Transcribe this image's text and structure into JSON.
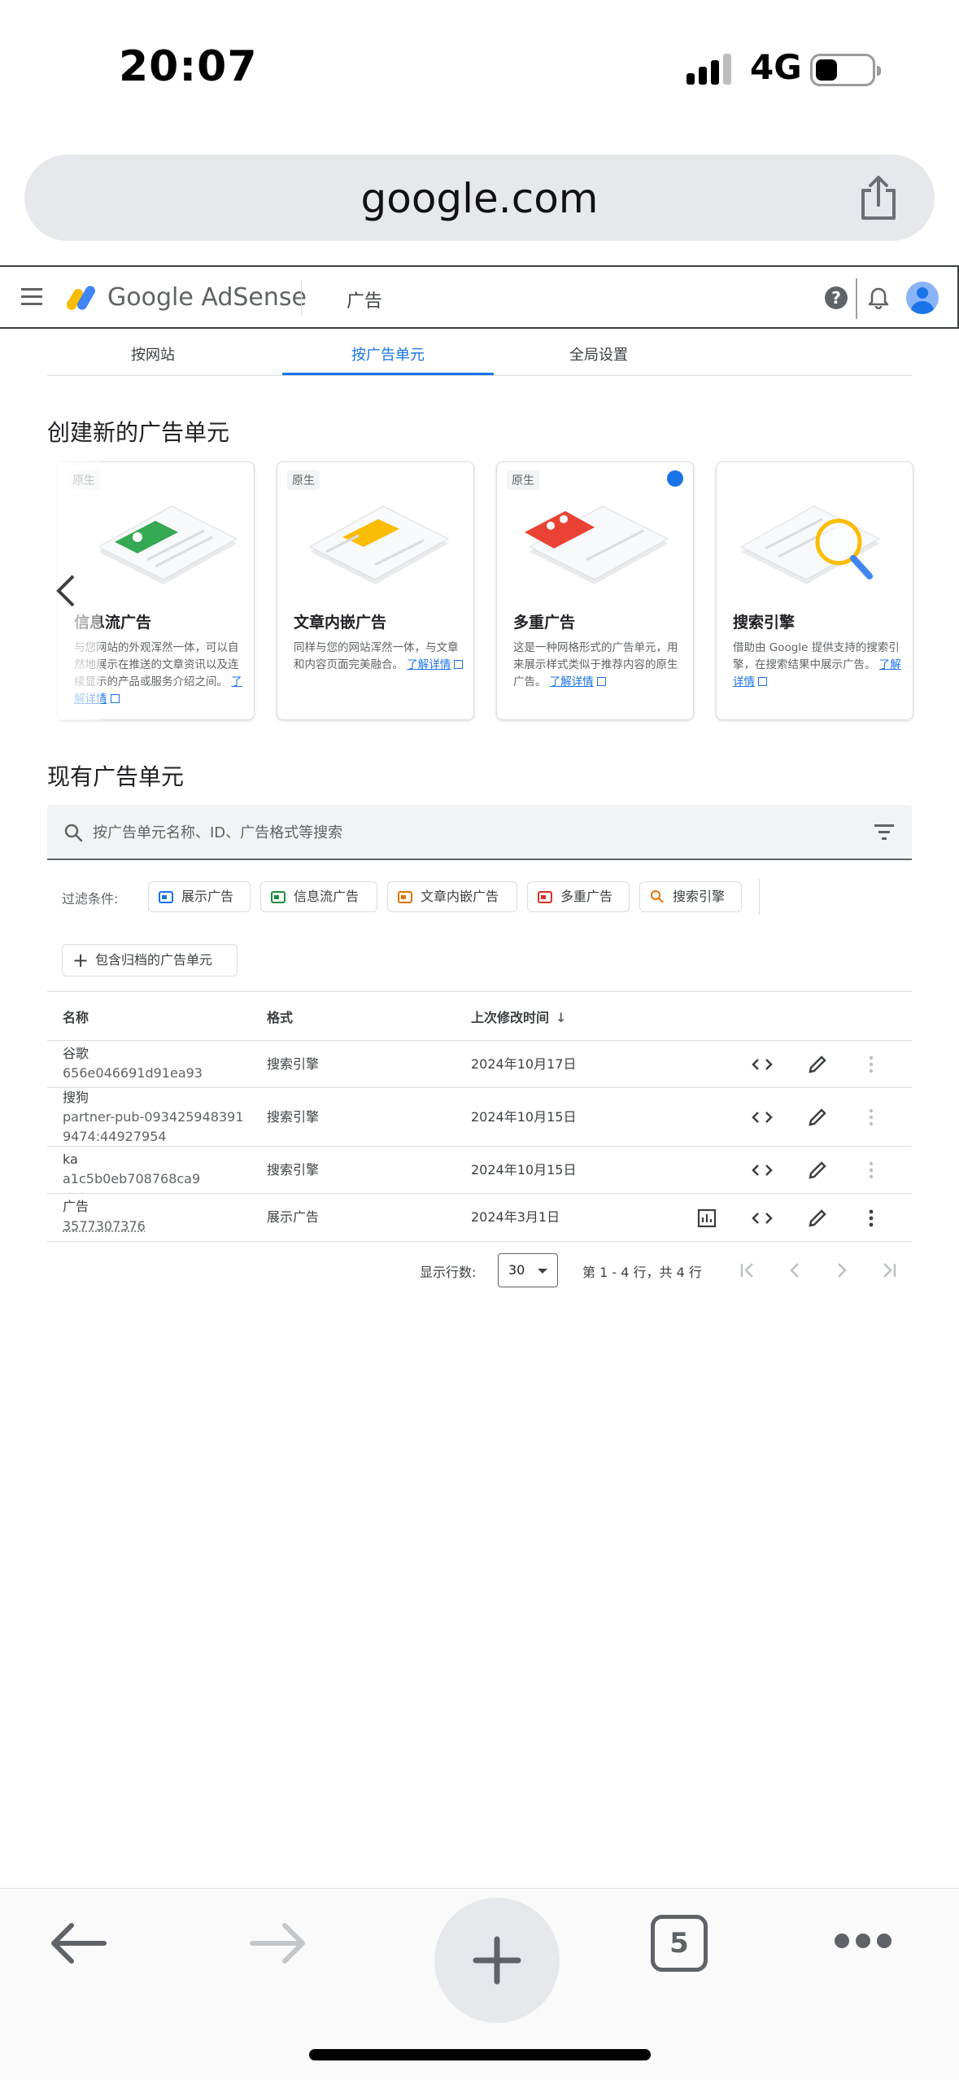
{
  "status_bar": {
    "time": "20:07",
    "network": "4G"
  },
  "browser": {
    "url": "google.com",
    "open_tabs": "5"
  },
  "header": {
    "brand": "Google AdSense",
    "section": "广告",
    "help": "?"
  },
  "tabs": [
    {
      "label": "按网站"
    },
    {
      "label": "按广告单元"
    },
    {
      "label": "全局设置"
    }
  ],
  "create_section": {
    "title": "创建新的广告单元",
    "cards": [
      {
        "chip": "原生",
        "title": "信息流广告",
        "desc": "与您网站的外观浑然一体，可以自然地展示在推送的文章资讯以及连续显示的产品或服务介绍之间。",
        "link": "了解详情"
      },
      {
        "chip": "原生",
        "title": "文章内嵌广告",
        "desc": "同样与您的网站浑然一体，与文章和内容页面完美融合。",
        "link": "了解详情"
      },
      {
        "chip": "原生",
        "title": "多重广告",
        "desc": "这是一种网格形式的广告单元，用来展示样式类似于推荐内容的原生广告。",
        "link": "了解详情"
      },
      {
        "chip": "",
        "title": "搜索引擎",
        "desc": "借助由 Google 提供支持的搜索引擎，在搜索结果中展示广告。",
        "link": "了解详情"
      }
    ]
  },
  "existing_section": {
    "title": "现有广告单元",
    "search_placeholder": "按广告单元名称、ID、广告格式等搜索",
    "filter_label": "过滤条件:",
    "filters": [
      {
        "label": "展示广告",
        "color": "#1a73e8"
      },
      {
        "label": "信息流广告",
        "color": "#1e8e3e"
      },
      {
        "label": "文章内嵌广告",
        "color": "#e37400"
      },
      {
        "label": "多重广告",
        "color": "#d93025"
      },
      {
        "label": "搜索引擎",
        "color": "#e37400"
      }
    ],
    "archive_button": "包含归档的广告单元"
  },
  "table": {
    "headers": {
      "name": "名称",
      "format": "格式",
      "modified": "上次修改时间"
    },
    "rows": [
      {
        "name": "谷歌",
        "id": "656e046691d91ea93",
        "format": "搜索引擎",
        "modified": "2024年10月17日"
      },
      {
        "name": "搜狗",
        "id": "partner-pub-0934259483919474:44927954",
        "format": "搜索引擎",
        "modified": "2024年10月15日"
      },
      {
        "name": "ka",
        "id": "a1c5b0eb708768ca9",
        "format": "搜索引擎",
        "modified": "2024年10月15日"
      },
      {
        "name": "广告",
        "id": "3577307376",
        "format": "展示广告",
        "modified": "2024年3月1日"
      }
    ]
  },
  "pagination": {
    "rows_label": "显示行数:",
    "rows_value": "30",
    "range": "第 1 - 4 行，共 4 行"
  }
}
